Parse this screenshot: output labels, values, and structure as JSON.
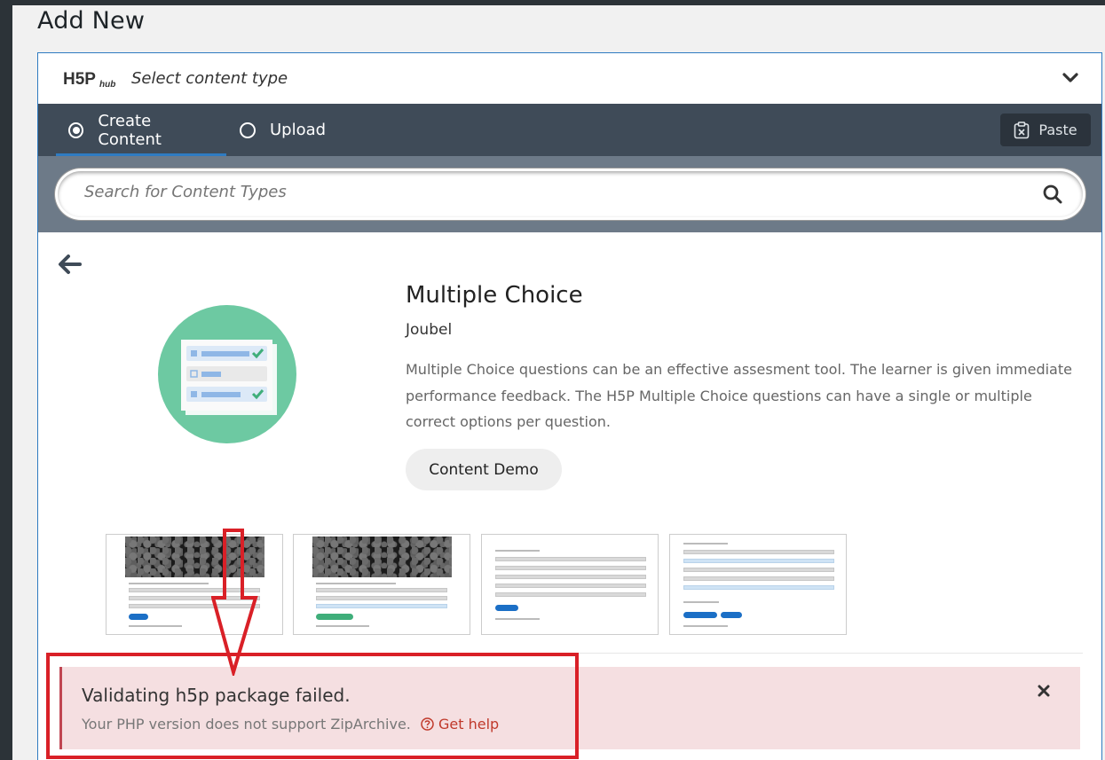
{
  "page": {
    "title": "Add New"
  },
  "hub": {
    "logo_text": "H5P",
    "logo_sub": "hub",
    "title": "Select content type"
  },
  "tabs": [
    {
      "label": "Create Content",
      "selected": true
    },
    {
      "label": "Upload",
      "selected": false
    }
  ],
  "paste": {
    "label": "Paste"
  },
  "search": {
    "placeholder": "Search for Content Types"
  },
  "content_type": {
    "title": "Multiple Choice",
    "owner": "Joubel",
    "description": "Multiple Choice questions can be an effective assesment tool. The learner is given immediate performance feedback. The H5P Multiple Choice questions can have a single or multiple correct options per question.",
    "demo_label": "Content Demo"
  },
  "error": {
    "title": "Validating h5p package failed.",
    "detail": "Your PHP version does not support ZipArchive.",
    "help_label": "Get help"
  },
  "colors": {
    "tab_bar": "#3f4b58",
    "search_area": "#6d7a88",
    "accent": "#2f7bc1",
    "icon_circle": "#6dc9a2",
    "error_bg": "#f5dfe1",
    "error_border": "#c04652",
    "annotation": "#d92027"
  }
}
